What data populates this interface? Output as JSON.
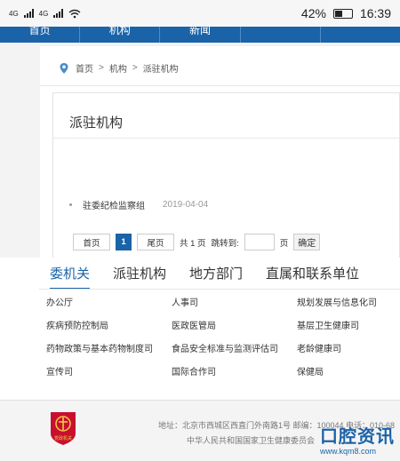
{
  "status_bar": {
    "sim1_label": "4G",
    "sim2_label": "4G",
    "battery": "42%",
    "time": "16:39"
  },
  "top_nav": {
    "items": [
      "首页",
      "机构",
      "新闻",
      "",
      ""
    ]
  },
  "breadcrumb": {
    "home": "首页",
    "sep": ">",
    "level2": "机构",
    "current": "派驻机构"
  },
  "section": {
    "title": "派驻机构",
    "items": [
      {
        "title": "驻委纪检监察组",
        "date": "2019-04-04"
      }
    ]
  },
  "pager": {
    "first": "首页",
    "current_page": "1",
    "last": "尾页",
    "total": "共 1 页",
    "jump_label": "跳转到:",
    "page_unit": "页",
    "confirm": "确定"
  },
  "tabs": [
    "委机关",
    "派驻机构",
    "地方部门",
    "直属和联系单位"
  ],
  "links": [
    "办公厅",
    "人事司",
    "规划发展与信息化司",
    "疾病预防控制局",
    "医政医管局",
    "基层卫生健康司",
    "药物政策与基本药物制度司",
    "食品安全标准与监测评估司",
    "老龄健康司",
    "宣传司",
    "国际合作司",
    "保健局"
  ],
  "footer": {
    "address": "地址：北京市西城区西直门外南路1号    邮编：100044    电话：010-68",
    "sponsor": "中华人民共和国国家卫生健康委员会",
    "emblem_text": "党政机关",
    "watermark_brand": "口腔资讯",
    "watermark_url": "www.kqm8.com"
  },
  "colors": {
    "primary": "#1b63a8",
    "emblem": "#c8102e"
  }
}
